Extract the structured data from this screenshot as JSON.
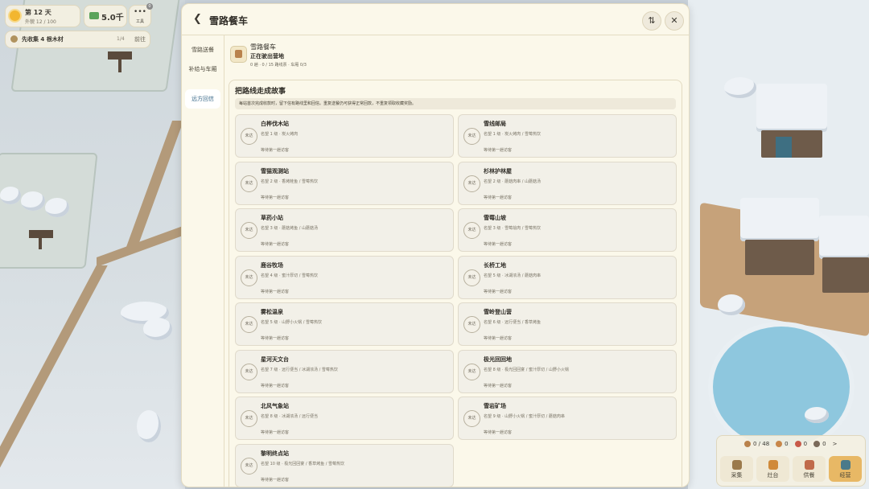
{
  "hud": {
    "day": "第 12 天",
    "day_sub": "外貌 12 / 100",
    "money": "5.0千",
    "tools_label": "工具",
    "tools_badge": "0",
    "quest": "先收集 4 根木材",
    "quest_count": "1/4",
    "quest_go": "前往"
  },
  "resources": {
    "items": [
      {
        "icon": "worker-icon",
        "value": "0 / 48",
        "color": "#b9824c"
      },
      {
        "icon": "wood-icon",
        "value": "0",
        "color": "#c8874a"
      },
      {
        "icon": "meat-icon",
        "value": "0",
        "color": "#c85a4a"
      },
      {
        "icon": "bowl-icon",
        "value": "0",
        "color": "#7a6a5a"
      }
    ],
    "more": ">",
    "buttons": [
      {
        "label": "采集",
        "active": false
      },
      {
        "label": "灶台",
        "active": false
      },
      {
        "label": "供餐",
        "active": false
      },
      {
        "label": "经营",
        "active": true
      }
    ]
  },
  "dialog": {
    "title": "雪路餐车",
    "nav": [
      "雪路送餐",
      "补给与车厢",
      "远方回信"
    ],
    "active_nav": 2,
    "train_name": "雪路餐车",
    "train_status": "正在驶出营地",
    "train_meta": "0 趟 · 0 / 15 路线票 · 车厢 0/3",
    "section_title": "把路线走成故事",
    "tip": "每站首次完成收款时，留下信有路线里和回信。重复送餐仍可获得正常回款，不重复领取收藏奖励。",
    "station_badge": "未达",
    "wait_text": "等待第一趟访客",
    "stations": [
      {
        "name": "白桦伐木站",
        "desc": "名望 1 级 · 炭火烤肉"
      },
      {
        "name": "雪线邮局",
        "desc": "名望 1 级 · 炭火烤肉 / 雪莓热饮"
      },
      {
        "name": "雪猫观测站",
        "desc": "名望 2 级 · 香烤鲑鱼 / 雪莓热饮"
      },
      {
        "name": "杉林护林屋",
        "desc": "名望 2 级 · 蘑菇肉串 / 山蘑菇汤"
      },
      {
        "name": "草药小站",
        "desc": "名望 3 级 · 蘑菇烤鱼 / 山蘑菇汤"
      },
      {
        "name": "雪莓山坡",
        "desc": "名望 3 级 · 雪莓烩肉 / 雪莓热饮"
      },
      {
        "name": "鹿谷牧场",
        "desc": "名望 4 级 · 蜜汁厚切 / 雪莓热饮"
      },
      {
        "name": "长桥工地",
        "desc": "名望 5 级 · 冰湖浓汤 / 蘑菇肉串"
      },
      {
        "name": "雾松温泉",
        "desc": "名望 5 级 · 山野小火锅 / 雪莓热饮"
      },
      {
        "name": "雪岭登山营",
        "desc": "名望 6 级 · 远行便当 / 香草烤鱼"
      },
      {
        "name": "星河天文台",
        "desc": "名望 7 级 · 远行便当 / 冰湖浓汤 / 雪莓热饮"
      },
      {
        "name": "极光回回地",
        "desc": "名望 8 级 · 极光回回宴 / 蜜汁厚切 / 山野小火锅"
      },
      {
        "name": "北风气象站",
        "desc": "名望 8 级 · 冰湖浓汤 / 远行便当"
      },
      {
        "name": "雪岩矿场",
        "desc": "名望 9 级 · 山野小火锅 / 蜜汁厚切 / 蘑菇肉串"
      },
      {
        "name": "黎明终点站",
        "desc": "名望 10 级 · 极光回回宴 / 香草烤鱼 / 雪莓热饮"
      }
    ]
  }
}
